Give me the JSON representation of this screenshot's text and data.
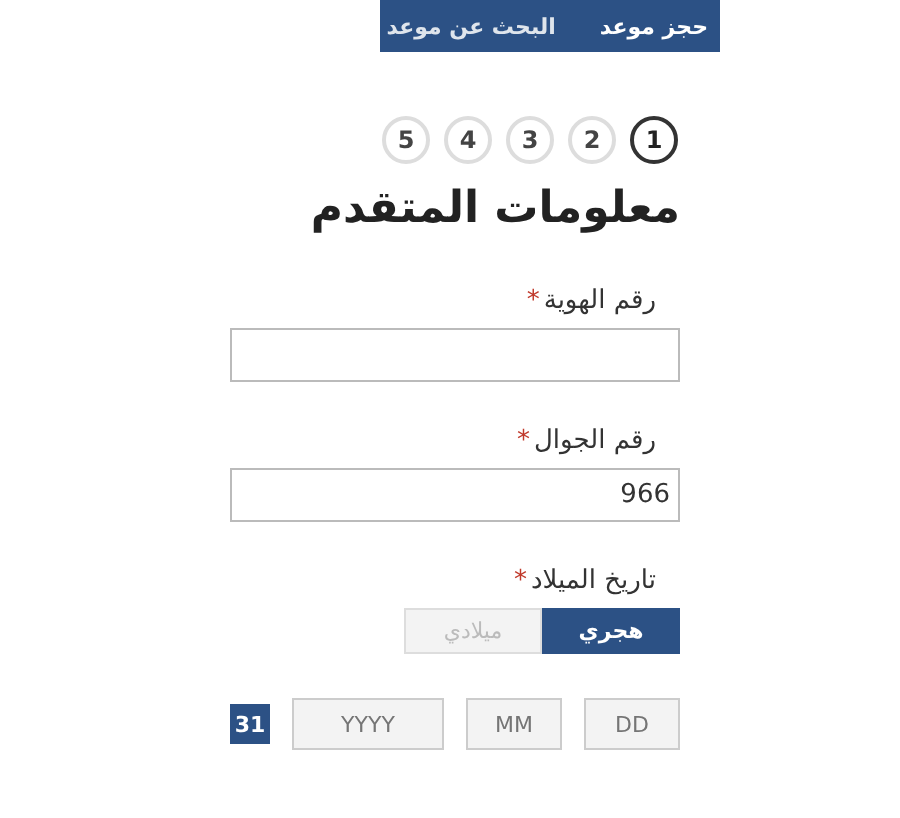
{
  "tabs": [
    {
      "label": "حجز موعد",
      "selected": true
    },
    {
      "label": "البحث عن موعد",
      "selected": false
    }
  ],
  "steps": [
    {
      "label": "1",
      "selected": true
    },
    {
      "label": "2",
      "selected": false
    },
    {
      "label": "3",
      "selected": false
    },
    {
      "label": "4",
      "selected": false
    },
    {
      "label": "5",
      "selected": false
    }
  ],
  "title": "معلومات المتقدم",
  "fields": [
    {
      "label": "رقم الهوية",
      "required_mark": "*"
    },
    {
      "label": "رقم الجوال",
      "required_mark": "*",
      "value": "966"
    }
  ],
  "birth_date": {
    "label": "تاريخ الميلاد",
    "required_mark": "*",
    "calendar_options": [
      {
        "label": "هجري",
        "selected": true
      },
      {
        "label": "ميلادي",
        "selected": false
      }
    ],
    "parts": [
      {
        "placeholder": "DD"
      },
      {
        "placeholder": "MM"
      },
      {
        "placeholder": "YYYY"
      }
    ],
    "calendar_button": "31"
  }
}
